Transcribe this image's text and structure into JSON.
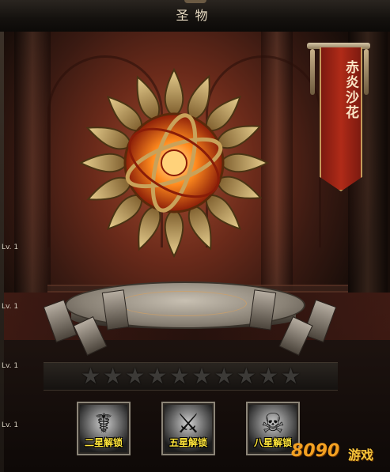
{
  "header": {
    "title": "圣物"
  },
  "relic": {
    "name": "赤炎沙花"
  },
  "levels": [
    "Lv. 1",
    "Lv. 1",
    "Lv. 1",
    "Lv. 1"
  ],
  "stars": {
    "total": 10,
    "filled": 0
  },
  "skills": [
    {
      "label": "二星解锁",
      "icon": "beast-silhouette-icon"
    },
    {
      "label": "五星解锁",
      "icon": "flame-sword-icon"
    },
    {
      "label": "八星解锁",
      "icon": "shadow-warrior-icon"
    }
  ],
  "watermark": {
    "digits": "8090",
    "brand": "游戏"
  },
  "colors": {
    "banner": "#b02b18",
    "unlock_text": "#ffe53a",
    "relic_gold": "#c9a25a",
    "relic_core": "#ff8a1e"
  }
}
